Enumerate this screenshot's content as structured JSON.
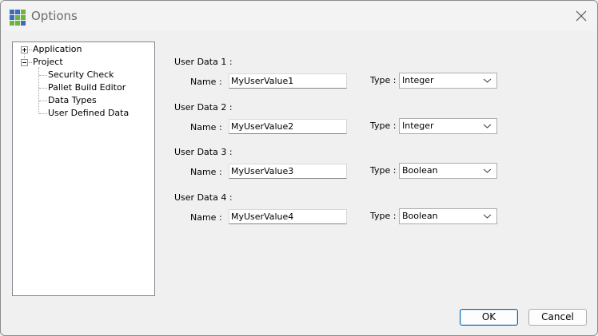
{
  "window": {
    "title": "Options"
  },
  "tree": {
    "nodes": [
      {
        "label": "Application",
        "expander": "+"
      },
      {
        "label": "Project",
        "expander": "-"
      }
    ],
    "project_children": [
      "Security Check",
      "Pallet Build Editor",
      "Data Types",
      "User Defined Data"
    ]
  },
  "user_data": [
    {
      "header": "User Data 1 :",
      "name_label": "Name :",
      "name_value": "MyUserValue1",
      "type_label": "Type :",
      "type_value": "Integer"
    },
    {
      "header": "User Data 2 :",
      "name_label": "Name :",
      "name_value": "MyUserValue2",
      "type_label": "Type :",
      "type_value": "Integer"
    },
    {
      "header": "User Data 3 :",
      "name_label": "Name :",
      "name_value": "MyUserValue3",
      "type_label": "Type :",
      "type_value": "Boolean"
    },
    {
      "header": "User Data 4 :",
      "name_label": "Name :",
      "name_value": "MyUserValue4",
      "type_label": "Type :",
      "type_value": "Boolean"
    }
  ],
  "buttons": {
    "ok": "OK",
    "cancel": "Cancel"
  },
  "colors": {
    "accent": "#0067c0",
    "window_bg": "#f0f0f0",
    "tree_border": "#828790"
  }
}
